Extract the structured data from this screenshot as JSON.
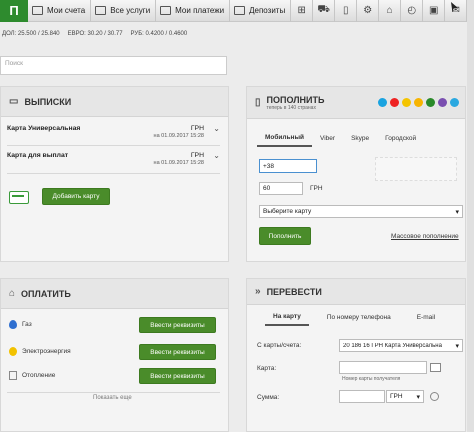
{
  "topnav": {
    "logo_text": "П",
    "items": [
      {
        "label": "Мои счета"
      },
      {
        "label": "Все услуги"
      },
      {
        "label": "Мои платежи"
      },
      {
        "label": "Депозиты"
      }
    ]
  },
  "rates": {
    "usd": "ДОЛ: 25.500 / 25.840",
    "eur": "ЕВРО: 30.20 / 30.77",
    "rub": "РУБ: 0.4200 / 0.4600"
  },
  "search": {
    "placeholder": "Поиск"
  },
  "statements": {
    "title": "ВЫПИСКИ",
    "cards": [
      {
        "name": "Карта Универсальная",
        "currency": "ГРН",
        "date": "на 01.09.2017 15:28"
      },
      {
        "name": "Карта для выплат",
        "currency": "ГРН",
        "date": "на 01.09.2017 15:28"
      }
    ],
    "add_card_label": "Добавить карту"
  },
  "topup": {
    "title": "ПОПОЛНИТЬ",
    "subtitle": "теперь в 140 странах",
    "tabs": [
      "Мобильный",
      "Viber",
      "Skype",
      "Городской"
    ],
    "phone_value": "+38",
    "amount_value": "60",
    "amount_currency": "ГРН",
    "card_select": "Выберите карту",
    "submit_label": "Пополнить",
    "bulk_link": "Массовое пополнение"
  },
  "pay": {
    "title": "ОПЛАТИТЬ",
    "rows": [
      {
        "label": "Газ",
        "button": "Ввести реквизиты"
      },
      {
        "label": "Электроэнергия",
        "button": "Ввести реквизиты"
      },
      {
        "label": "Отопление",
        "button": "Ввести реквизиты"
      }
    ],
    "show_more": "Показать еще"
  },
  "transfer": {
    "title": "ПЕРЕВЕСТИ",
    "tabs": [
      "На карту",
      "По номеру телефона",
      "E-mail"
    ],
    "from_label": "С карты/счета:",
    "from_value": "20 186 16 ГРН  Карта Универсальна",
    "card_label": "Карта:",
    "card_hint": "Номер карты получателя",
    "sum_label": "Сумма:",
    "sum_currency": "ГРН"
  },
  "colors": {
    "accent_green": "#4a8c2a",
    "logo_green": "#2e8b2e"
  }
}
